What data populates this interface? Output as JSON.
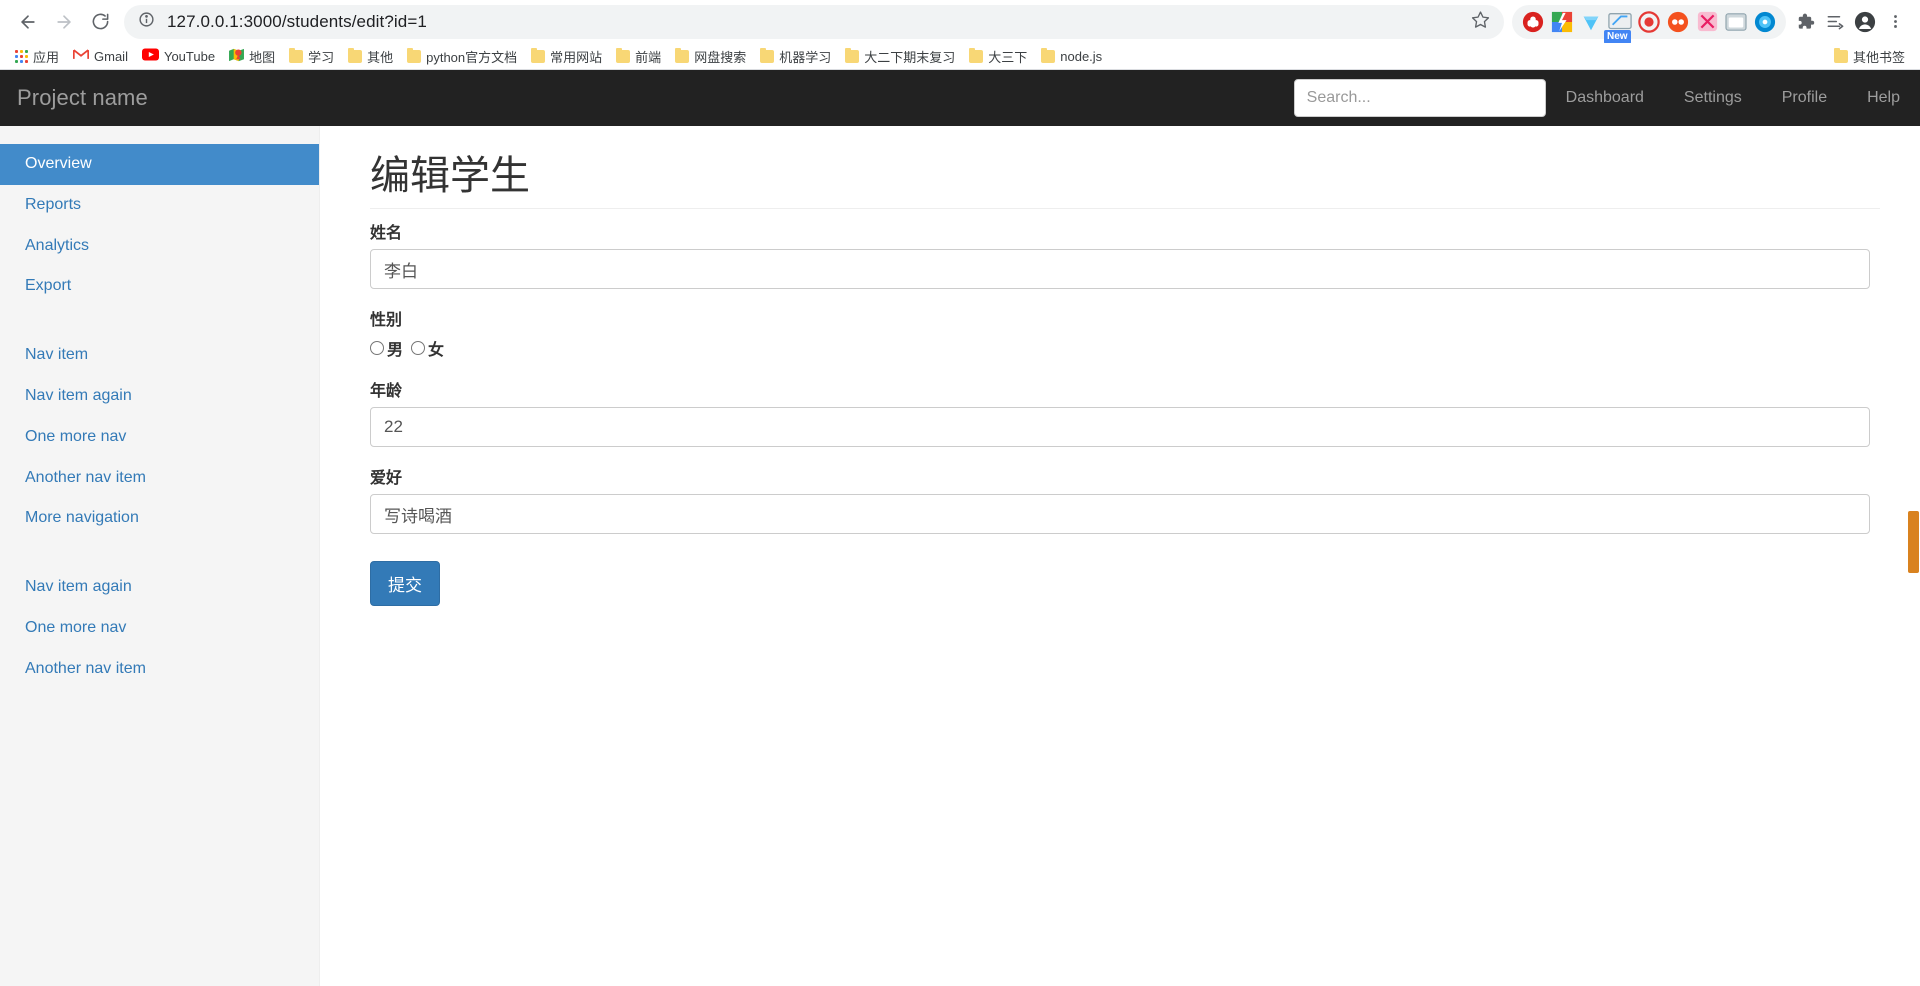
{
  "browser": {
    "back_tooltip": "Back",
    "forward_tooltip": "Forward",
    "reload_tooltip": "Reload",
    "url": "127.0.0.1:3000/students/edit?id=1",
    "site_info_icon": "info-circle-icon",
    "bookmark_star_icon": "star-icon",
    "extensions": [
      {
        "name": "adblock-extension-icon",
        "color": "#d9221f"
      },
      {
        "name": "colorful-square-extension-icon",
        "color": "#34a853"
      },
      {
        "name": "blue-diamond-extension-icon",
        "color": "#4fc3f7"
      },
      {
        "name": "screenshot-extension-icon",
        "color": "#4285f4",
        "badge": "New"
      },
      {
        "name": "red-circle-extension-icon",
        "color": "#e53935"
      },
      {
        "name": "orange-circle-extension-icon",
        "color": "#f4511e"
      },
      {
        "name": "pink-square-extension-icon",
        "color": "#ec407a"
      },
      {
        "name": "grey-window-extension-icon",
        "color": "#78909c"
      },
      {
        "name": "cyan-circle-extension-icon",
        "color": "#00acc1"
      }
    ],
    "toolbar_icons": [
      {
        "name": "puzzle-extensions-icon"
      },
      {
        "name": "reading-list-icon"
      },
      {
        "name": "profile-avatar-icon"
      },
      {
        "name": "kebab-menu-icon"
      }
    ]
  },
  "bookmarks": {
    "apps_label": "应用",
    "items": [
      {
        "label": "Gmail",
        "icon": "gmail-icon"
      },
      {
        "label": "YouTube",
        "icon": "youtube-icon"
      },
      {
        "label": "地图",
        "icon": "maps-icon"
      },
      {
        "label": "学习",
        "icon": "folder-icon"
      },
      {
        "label": "其他",
        "icon": "folder-icon"
      },
      {
        "label": "python官方文档",
        "icon": "folder-icon"
      },
      {
        "label": "常用网站",
        "icon": "folder-icon"
      },
      {
        "label": "前端",
        "icon": "folder-icon"
      },
      {
        "label": "网盘搜索",
        "icon": "folder-icon"
      },
      {
        "label": "机器学习",
        "icon": "folder-icon"
      },
      {
        "label": "大二下期末复习",
        "icon": "folder-icon"
      },
      {
        "label": "大三下",
        "icon": "folder-icon"
      },
      {
        "label": "node.js",
        "icon": "folder-icon"
      }
    ],
    "other_bookmarks": "其他书签"
  },
  "navbar": {
    "brand": "Project name",
    "search_placeholder": "Search...",
    "search_value": "",
    "links": [
      {
        "label": "Dashboard"
      },
      {
        "label": "Settings"
      },
      {
        "label": "Profile"
      },
      {
        "label": "Help"
      }
    ]
  },
  "sidebar": {
    "group1": [
      {
        "label": "Overview",
        "active": true
      },
      {
        "label": "Reports",
        "active": false
      },
      {
        "label": "Analytics",
        "active": false
      },
      {
        "label": "Export",
        "active": false
      }
    ],
    "group2": [
      {
        "label": "Nav item"
      },
      {
        "label": "Nav item again"
      },
      {
        "label": "One more nav"
      },
      {
        "label": "Another nav item"
      },
      {
        "label": "More navigation"
      }
    ],
    "group3": [
      {
        "label": "Nav item again"
      },
      {
        "label": "One more nav"
      },
      {
        "label": "Another nav item"
      }
    ]
  },
  "main": {
    "title": "编辑学生",
    "fields": {
      "name_label": "姓名",
      "name_value": "李白",
      "gender_label": "性别",
      "gender_male": "男",
      "gender_female": "女",
      "gender_selected": "",
      "age_label": "年龄",
      "age_value": "22",
      "hobby_label": "爱好",
      "hobby_value": "写诗喝酒"
    },
    "submit_label": "提交"
  },
  "colors": {
    "navbar_bg": "#222222",
    "sidebar_active": "#428bca",
    "link_blue": "#337ab7",
    "button_blue": "#337ab7",
    "scrollbar_thumb": "#d9821f"
  }
}
